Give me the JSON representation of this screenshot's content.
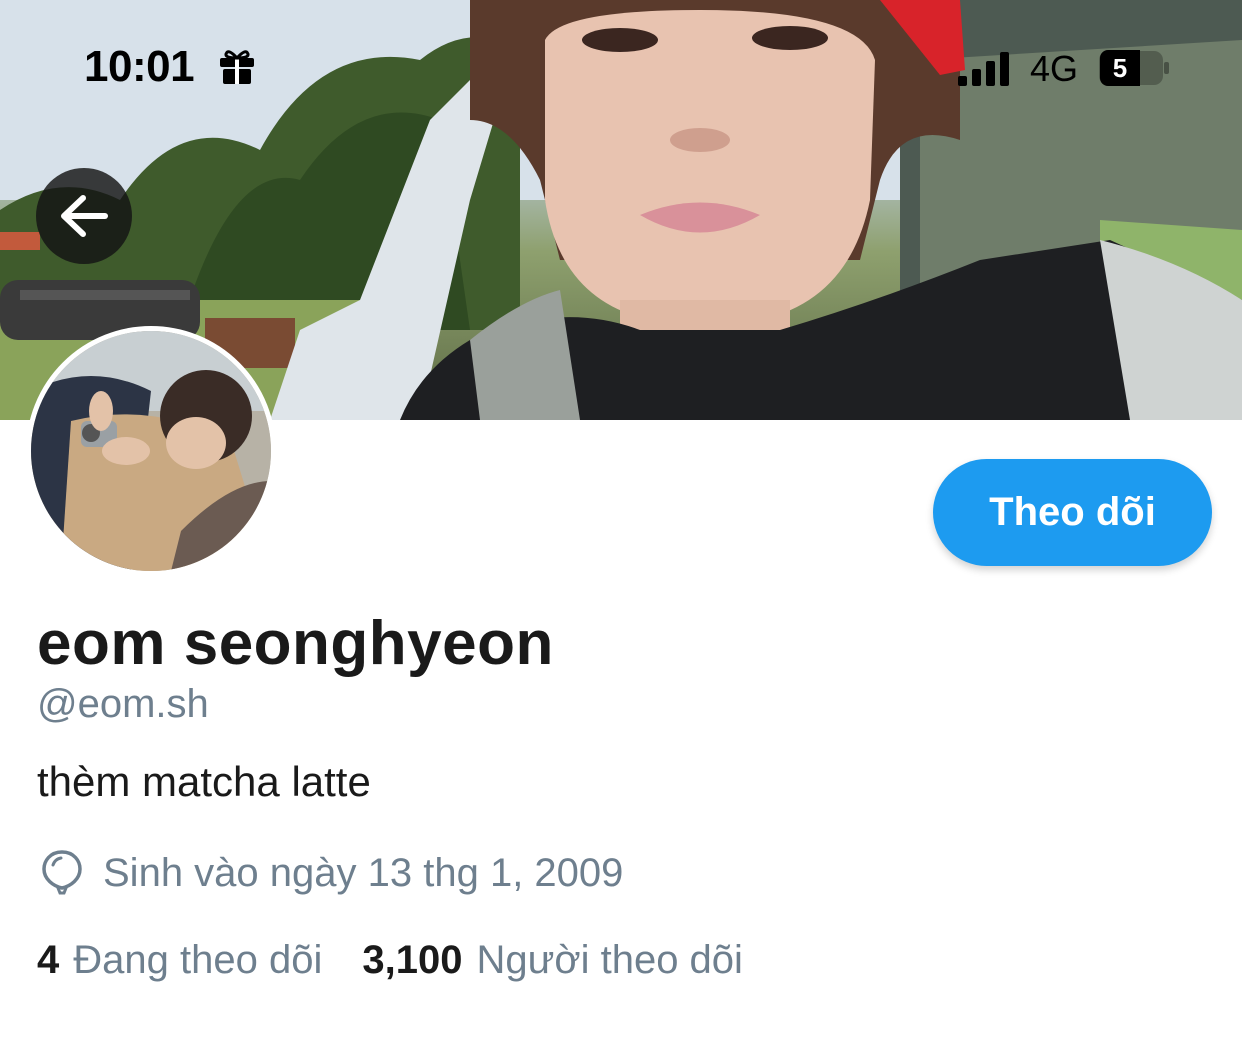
{
  "status_bar": {
    "time": "10:01",
    "network": "4G",
    "battery": "5"
  },
  "profile": {
    "display_name": "eom seonghyeon",
    "handle": "@eom.sh",
    "bio": "thèm matcha latte",
    "birthday": "Sinh vào ngày 13 thg 1, 2009",
    "following_count": "4",
    "following_label": "Đang theo dõi",
    "followers_count": "3,100",
    "followers_label": "Người theo dõi"
  },
  "actions": {
    "follow_label": "Theo dõi"
  },
  "colors": {
    "accent": "#1d9bf0",
    "secondary_text": "#6e7f8e"
  },
  "icons": [
    "gift-icon",
    "signal-icon",
    "battery-icon",
    "back-arrow-icon",
    "balloon-icon"
  ]
}
